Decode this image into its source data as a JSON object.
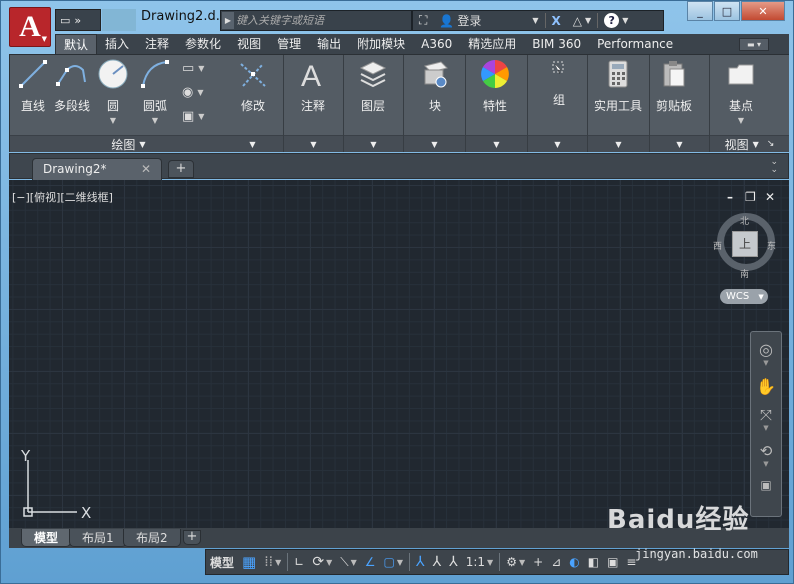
{
  "window": {
    "title": "Drawing2.d...",
    "minimize": "_",
    "restore": "□",
    "close": "✕"
  },
  "app_menu": {
    "letter": "A"
  },
  "search": {
    "placeholder": "键入关键字或短语"
  },
  "topbar": {
    "login": "登录",
    "help": "?"
  },
  "ribbon_tabs": [
    "默认",
    "插入",
    "注释",
    "参数化",
    "视图",
    "管理",
    "输出",
    "附加模块",
    "A360",
    "精选应用",
    "BIM 360",
    "Performance"
  ],
  "ribbon": {
    "draw_buttons": [
      {
        "label": "直线",
        "icon": "line-icon"
      },
      {
        "label": "多段线",
        "icon": "polyline-icon"
      },
      {
        "label": "圆",
        "icon": "circle-icon"
      },
      {
        "label": "圆弧",
        "icon": "arc-icon"
      }
    ],
    "draw_panel_title": "绘图",
    "panels": [
      {
        "label": "修改",
        "icon": "modify-icon"
      },
      {
        "label": "注释",
        "icon": "annotation-icon"
      },
      {
        "label": "图层",
        "icon": "layers-icon"
      },
      {
        "label": "块",
        "icon": "block-icon"
      },
      {
        "label": "特性",
        "icon": "properties-icon"
      },
      {
        "label": "组",
        "icon": "group-icon"
      },
      {
        "label": "实用工具",
        "icon": "utilities-icon"
      },
      {
        "label": "剪贴板",
        "icon": "clipboard-icon"
      }
    ],
    "view_panel": {
      "button": "基点",
      "title": "视图"
    }
  },
  "file_tabs": [
    {
      "label": "Drawing2*"
    }
  ],
  "viewport": {
    "label": "[−][俯视][二维线框]",
    "viewcube": {
      "top": "上",
      "north": "北",
      "south": "南",
      "east": "东",
      "west": "西"
    },
    "wcs": "WCS",
    "ucs_x": "X",
    "ucs_y": "Y"
  },
  "layout_tabs": [
    "模型",
    "布局1",
    "布局2"
  ],
  "statusbar": {
    "model": "模型",
    "scale": "1:1"
  },
  "watermark": {
    "brand": "Baidu经验",
    "url": "jingyan.baidu.com"
  },
  "colors": {
    "accent": "#b8262b",
    "ribbon_bg": "#545c64",
    "canvas_bg": "#212830",
    "window_frame": "#6aa9d8"
  }
}
